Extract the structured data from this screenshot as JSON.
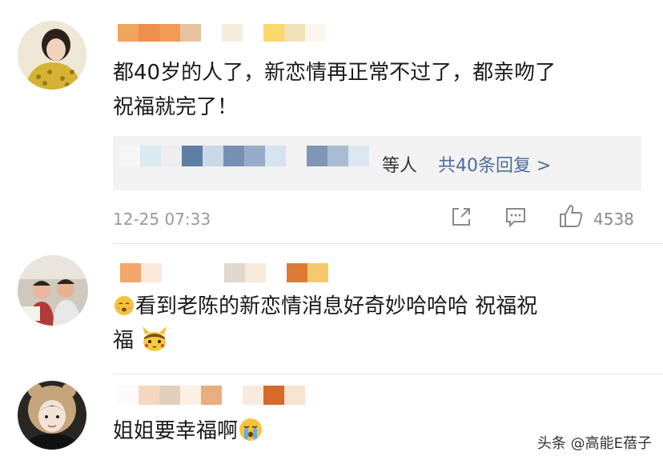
{
  "comments": [
    {
      "text_line1": "都40岁的人了，新恋情再正常不过了，都亲吻了",
      "text_line2": "祝福就完了！",
      "reply_summary": {
        "others_label": "等人",
        "link_label": "共40条回复 >"
      },
      "time": "12-25 07:33",
      "like_count": "4538",
      "icons": [
        "share-icon",
        "comment-icon",
        "thumbs-up-icon"
      ]
    },
    {
      "text_line1": "看到老陈的新恋情消息好奇妙哈哈哈 祝福祝",
      "text_line2": "福",
      "icons": [
        "face-emoji-icon",
        "pikachu-emoji-icon"
      ]
    },
    {
      "text_line1": "姐姐要幸福啊",
      "icons": [
        "crying-emoji-icon"
      ]
    }
  ],
  "watermark": "头条 @高能E蓓子",
  "colors": {
    "link": "#4c6d9c",
    "meta_gray": "#9a9a9a",
    "reply_bg": "#f2f2f2"
  }
}
